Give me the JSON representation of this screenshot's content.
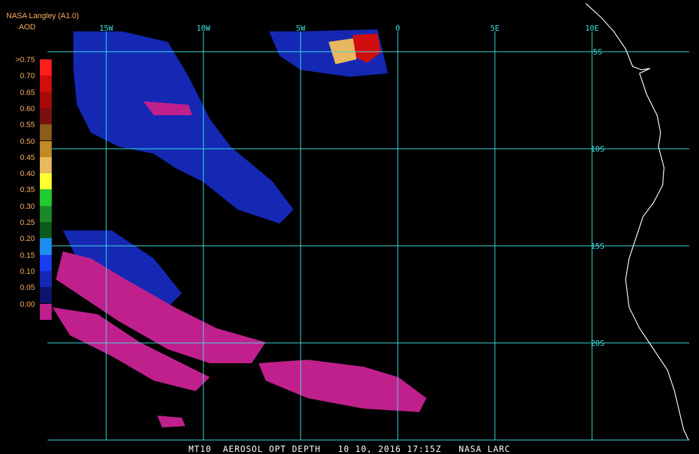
{
  "header": {
    "source": "NASA Langley (A1.0)",
    "product": "AOD"
  },
  "legend": {
    "items": [
      {
        "label": ">0.75",
        "color": "#ff1c1c"
      },
      {
        "label": "0.70",
        "color": "#d00e0e"
      },
      {
        "label": "0.65",
        "color": "#a80a0a"
      },
      {
        "label": "0.60",
        "color": "#7c1010"
      },
      {
        "label": "0.55",
        "color": "#8a5e1a"
      },
      {
        "label": "0.50",
        "color": "#c08a25"
      },
      {
        "label": "0.45",
        "color": "#e8b860"
      },
      {
        "label": "0.40",
        "color": "#ffff30"
      },
      {
        "label": "0.35",
        "color": "#20cc30"
      },
      {
        "label": "0.30",
        "color": "#1a8a28"
      },
      {
        "label": "0.25",
        "color": "#0e5a1c"
      },
      {
        "label": "0.20",
        "color": "#1c8ef0"
      },
      {
        "label": "0.15",
        "color": "#1a3cf0"
      },
      {
        "label": "0.10",
        "color": "#1428b4"
      },
      {
        "label": "0.05",
        "color": "#0c1470"
      },
      {
        "label": "0.00",
        "color": "#c0208c"
      }
    ]
  },
  "map": {
    "lon_labels": [
      "15W",
      "10W",
      "5W",
      "0",
      "5E",
      "10E"
    ],
    "lat_labels": [
      "5S",
      "10S",
      "15S",
      "20S"
    ],
    "lon_values": [
      -15,
      -10,
      -5,
      0,
      5,
      10
    ],
    "lat_values": [
      -5,
      -10,
      -15,
      -20
    ],
    "lon_range": [
      -18,
      13
    ],
    "lat_range": [
      -25,
      -3.4
    ],
    "grid_color": "#40e0e0",
    "coast_color": "#ffffff",
    "aod_low_color": "#c0208c",
    "aod_blue_color": "#1428b4"
  },
  "footer": {
    "text": "MT10  AEROSOL OPT DEPTH   10 10, 2016 17:15Z   NASA LARC"
  }
}
